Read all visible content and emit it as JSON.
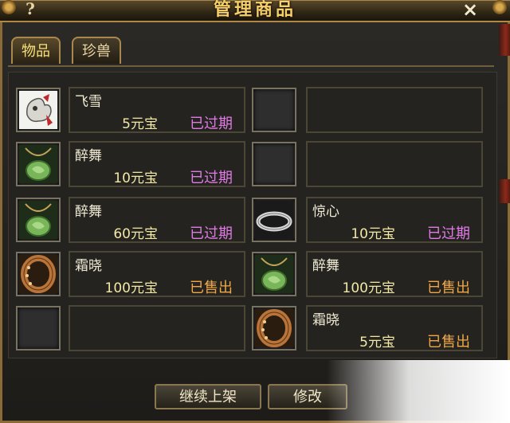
{
  "window": {
    "title": "管理商品",
    "help_label": "?",
    "close_label": "×"
  },
  "tabs": [
    {
      "label": "物品",
      "active": true
    },
    {
      "label": "珍兽",
      "active": false
    }
  ],
  "items": [
    {
      "name": "飞雪",
      "price": "5元宝",
      "status": "已过期",
      "icon": "feixue-pet-icon"
    },
    {
      "name": "",
      "price": "",
      "status": "",
      "icon": "empty-slot-icon"
    },
    {
      "name": "醉舞",
      "price": "10元宝",
      "status": "已过期",
      "icon": "jade-pendant-icon"
    },
    {
      "name": "",
      "price": "",
      "status": "",
      "icon": "empty-slot-icon"
    },
    {
      "name": "醉舞",
      "price": "60元宝",
      "status": "已过期",
      "icon": "jade-pendant-icon"
    },
    {
      "name": "惊心",
      "price": "10元宝",
      "status": "已过期",
      "icon": "silver-ring-icon"
    },
    {
      "name": "霜晓",
      "price": "100元宝",
      "status": "已售出",
      "icon": "bronze-bracelet-icon"
    },
    {
      "name": "醉舞",
      "price": "100元宝",
      "status": "已售出",
      "icon": "jade-pendant-icon"
    },
    {
      "name": "",
      "price": "",
      "status": "",
      "icon": "empty-slot-icon"
    },
    {
      "name": "霜晓",
      "price": "5元宝",
      "status": "已售出",
      "icon": "bronze-bracelet-icon"
    }
  ],
  "buttons": {
    "continue_listing": "继续上架",
    "modify": "修改"
  },
  "colors": {
    "expired": "#e07be6",
    "sold": "#f0a845",
    "title": "#f5cf6a"
  }
}
